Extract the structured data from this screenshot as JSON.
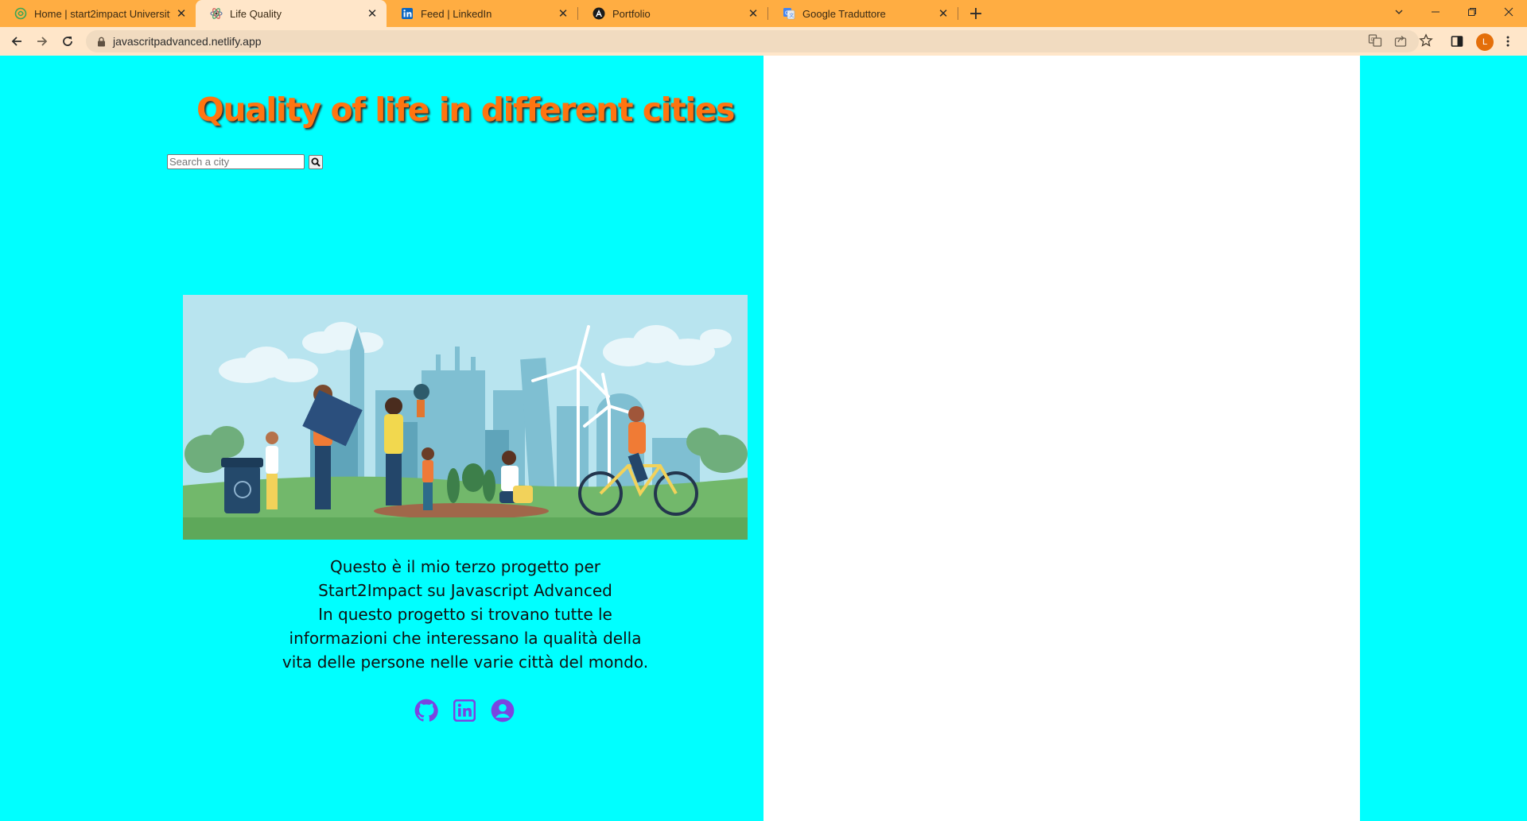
{
  "browser": {
    "tabs": [
      {
        "title": "Home | start2impact University",
        "icon": "start2impact-icon",
        "active": false
      },
      {
        "title": "Life Quality",
        "icon": "atom-icon",
        "active": true
      },
      {
        "title": "Feed | LinkedIn",
        "icon": "linkedin-icon",
        "active": false
      },
      {
        "title": "Portfolio",
        "icon": "angular-icon",
        "active": false
      },
      {
        "title": "Google Traduttore",
        "icon": "google-translate-icon",
        "active": false
      }
    ],
    "close_glyph": "✕",
    "new_tab_glyph": "+",
    "url": "javascritpadvanced.netlify.app",
    "profile_initial": "L",
    "colors": {
      "tabbar": "#ffad42",
      "toolbar": "#ffe6c9",
      "profile": "#e46f0a"
    }
  },
  "page": {
    "title": "Quality of life in different cities",
    "search": {
      "placeholder": "Search a city",
      "value": "",
      "button_icon": "search-icon"
    },
    "description": [
      "Questo è il mio terzo progetto per",
      "Start2Impact su Javascript Advanced",
      "In questo progetto si trovano tutte le",
      "informazioni che interessano la qualità della",
      "vita delle persone nelle varie città del mondo."
    ],
    "socials": [
      {
        "name": "github-icon"
      },
      {
        "name": "linkedin-icon"
      },
      {
        "name": "user-profile-icon"
      }
    ],
    "colors": {
      "background": "#00ffff",
      "title": "#ff7410",
      "panel": "#ffffff",
      "social": "#7b45e0"
    }
  }
}
